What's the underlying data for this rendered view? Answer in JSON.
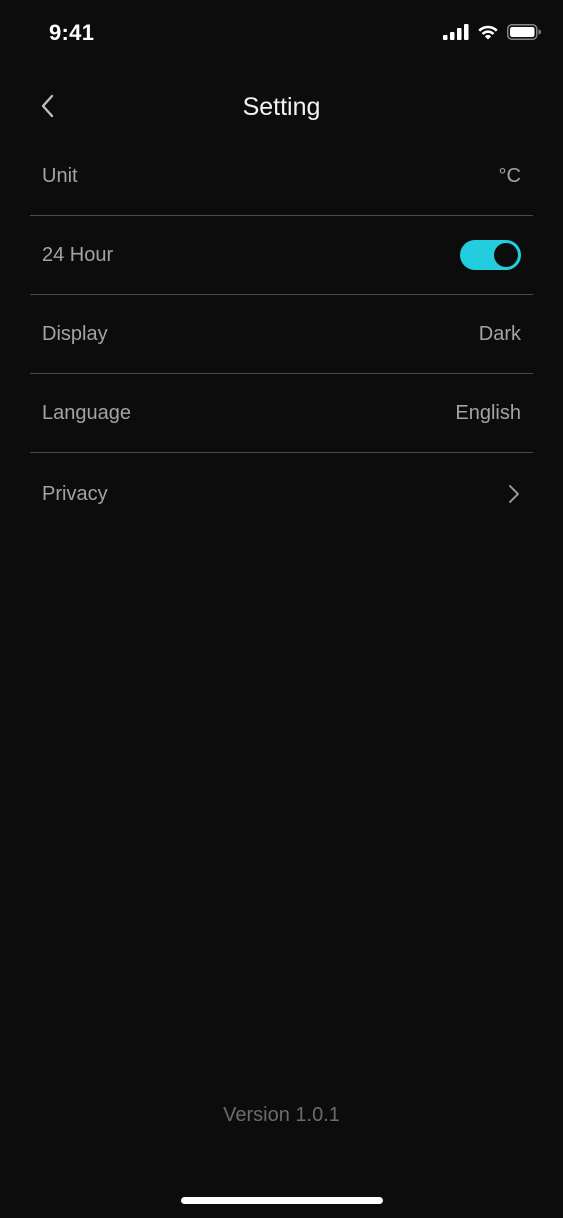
{
  "status_bar": {
    "time": "9:41",
    "icons": [
      "signal-icon",
      "wifi-icon",
      "battery-icon"
    ]
  },
  "nav": {
    "title": "Setting",
    "back_icon": "chevron-left-icon"
  },
  "settings": {
    "unit": {
      "label": "Unit",
      "value": "°C"
    },
    "hour24": {
      "label": "24 Hour",
      "enabled": true
    },
    "display": {
      "label": "Display",
      "value": "Dark"
    },
    "language": {
      "label": "Language",
      "value": "English"
    },
    "privacy": {
      "label": "Privacy",
      "icon": "chevron-right-icon"
    }
  },
  "footer": {
    "version": "Version 1.0.1"
  },
  "colors": {
    "background": "#0c0c0c",
    "accent": "#22cde0",
    "label": "#a3a3a3",
    "divider": "#4a4a4a",
    "version_text": "#6b6b6b"
  }
}
